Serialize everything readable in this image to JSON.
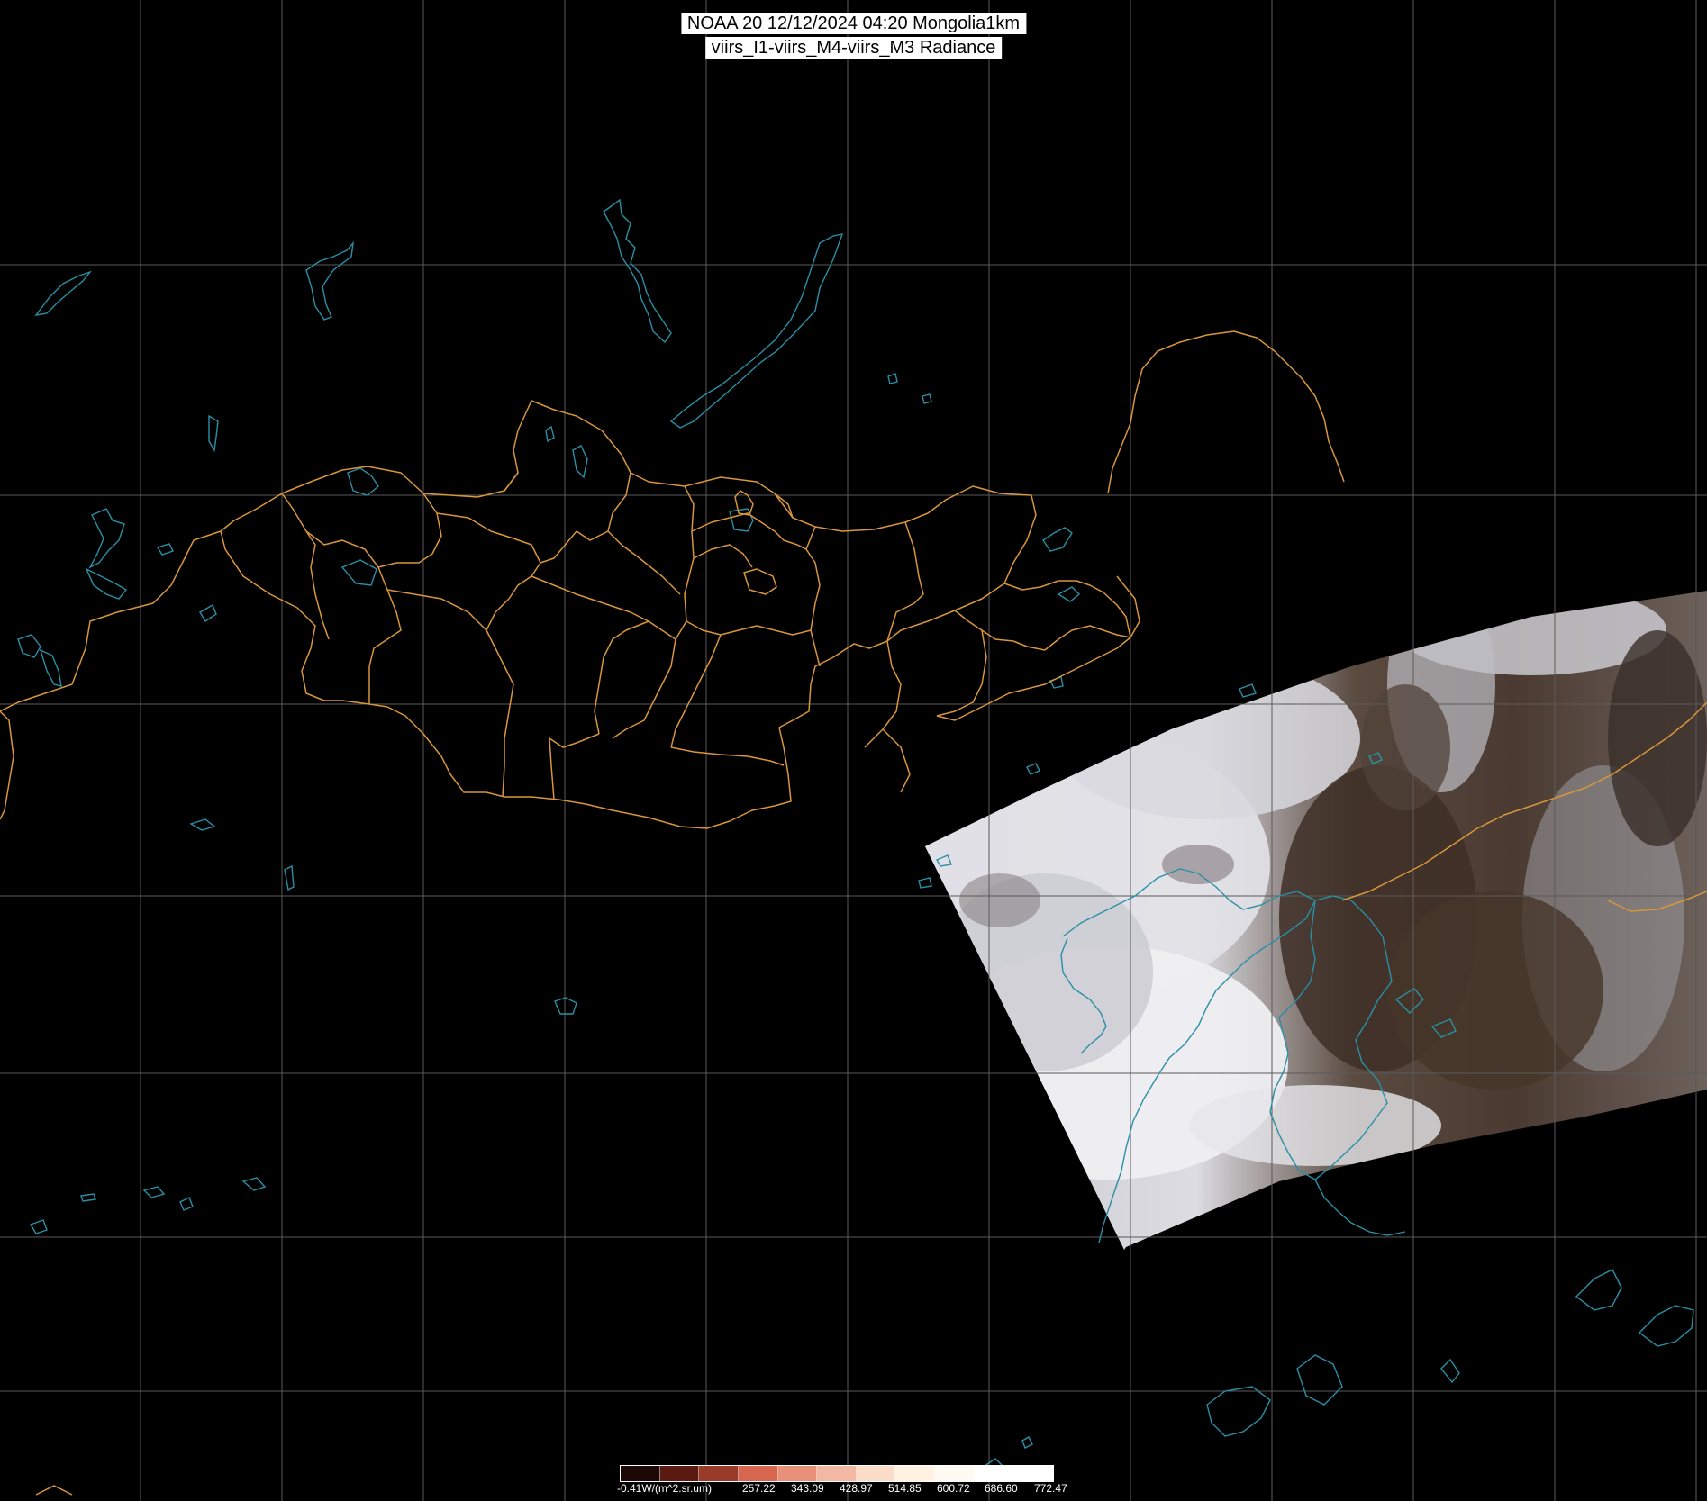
{
  "header": {
    "line1": "NOAA 20 12/12/2024 04:20 Mongolia1km",
    "line2": "viirs_I1-viirs_M4-viirs_M3 Radiance"
  },
  "legend": {
    "labels": [
      "-0.41W/(m^2.sr.um)",
      "257.22",
      "343.09",
      "428.97",
      "514.85",
      "600.72",
      "686.60",
      "772.47"
    ],
    "colors": [
      "#1e0806",
      "#5a1a12",
      "#9a3a28",
      "#d8654e",
      "#e8907a",
      "#f2b8a4",
      "#fadcc8",
      "#fff2e2",
      "#fffbf2",
      "#ffffff",
      "#ffffff"
    ]
  },
  "map": {
    "region": "Mongolia",
    "background": "#000000",
    "grid_color": "#5a5a5a",
    "border_color": "#d8963c",
    "coast_color": "#2a8fa6",
    "imagery_colors": [
      "#e6e6ea",
      "#cfcfd6",
      "#4a3a32",
      "#3b2c25"
    ]
  }
}
